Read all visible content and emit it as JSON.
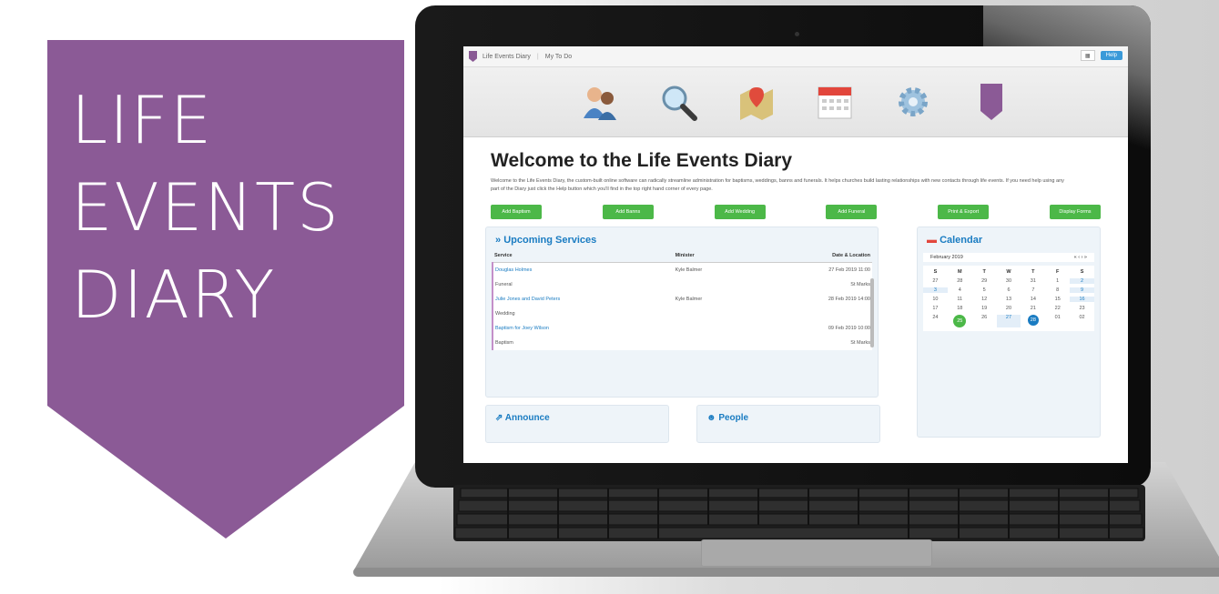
{
  "logo": {
    "lines": [
      "LIFE",
      "EVENTS",
      "DIARY"
    ],
    "color": "#8b5a96"
  },
  "topbar": {
    "app_name": "Life Events Diary",
    "org": "My To Do",
    "help_label": "Help",
    "menu_label": "▦"
  },
  "nav_icons": [
    "people-icon",
    "search-icon",
    "map-icon",
    "calendar-icon",
    "settings-icon",
    "diary-logo-icon"
  ],
  "welcome": {
    "title": "Welcome to the Life Events Diary",
    "intro": "Welcome to the Life Events Diary, the custom-built online software can radically streamline administration for baptisms, weddings, banns and funerals. It helps churches build lasting relationships with new contacts through life events. If you need help using any part of the Diary just click the Help button which you'll find in the top right hand corner of every page."
  },
  "buttons": [
    "Add Baptism",
    "Add Banns",
    "Add Wedding",
    "Add Funeral",
    "Print & Export",
    "Display Forms"
  ],
  "services": {
    "title": "Upcoming Services",
    "columns": [
      "Service",
      "Minister",
      "Date & Location"
    ],
    "rows": [
      {
        "service": "Douglas Holmes",
        "minister": "Kyle Balmer",
        "date": "27 Feb 2019 11:00"
      },
      {
        "service": "Funeral",
        "minister": "",
        "date": "St Marks"
      },
      {
        "service": "Julie Jones and David Peters",
        "minister": "Kyle Balmer",
        "date": "28 Feb 2019 14:00"
      },
      {
        "service": "Wedding",
        "minister": "",
        "date": ""
      },
      {
        "service": "Baptism for Joey Wilson",
        "minister": "",
        "date": "09 Feb 2019 10:00"
      },
      {
        "service": "Baptism",
        "minister": "",
        "date": "St Marks"
      }
    ]
  },
  "calendar": {
    "title": "Calendar",
    "month": "February 2019",
    "nav": "« ‹   › »",
    "days": [
      "S",
      "M",
      "T",
      "W",
      "T",
      "F",
      "S"
    ],
    "cells": [
      "27",
      "28",
      "29",
      "30",
      "31",
      "1",
      "2",
      "3",
      "4",
      "5",
      "6",
      "7",
      "8",
      "9",
      "10",
      "11",
      "12",
      "13",
      "14",
      "15",
      "16",
      "17",
      "18",
      "19",
      "20",
      "21",
      "22",
      "23",
      "24",
      "25",
      "26",
      "27",
      "28",
      "01",
      "02"
    ]
  },
  "announce": {
    "title": "Announce"
  },
  "people": {
    "title": "People"
  }
}
